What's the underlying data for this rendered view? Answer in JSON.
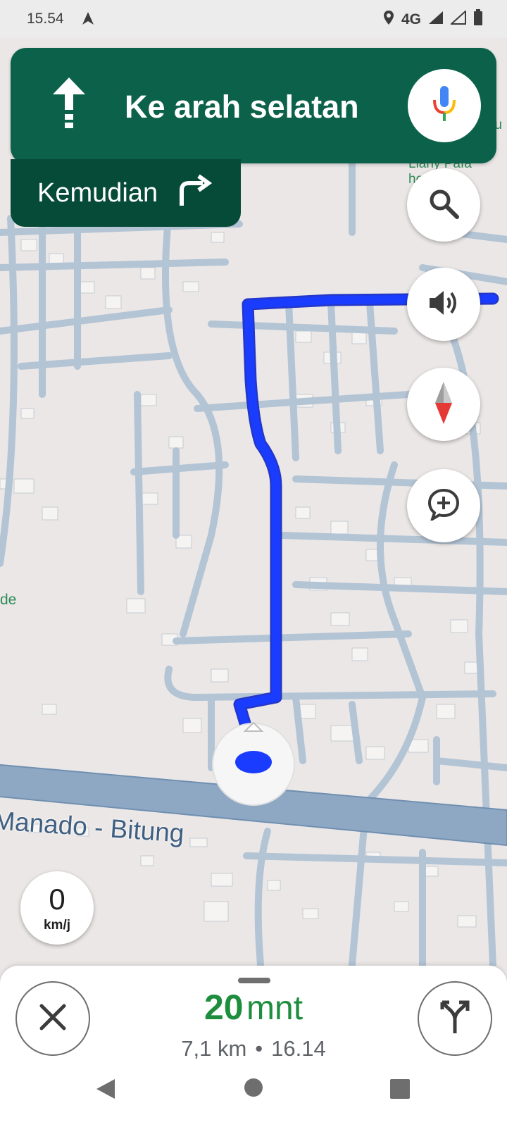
{
  "status_bar": {
    "time": "15.54",
    "network": "4G"
  },
  "map": {
    "road_label": "Manado - Bitung",
    "poi_label": "Liany Pafa home",
    "poi_label_cut": "ru",
    "side_label": "de"
  },
  "direction": {
    "instruction": "Ke arah selatan",
    "then_label": "Kemudian"
  },
  "speed": {
    "value": "0",
    "unit": "km/j"
  },
  "trip": {
    "duration_value": "20",
    "duration_unit": "mnt",
    "distance": "7,1 km",
    "separator": "•",
    "arrival_time": "16.14"
  },
  "colors": {
    "banner": "#0b6149",
    "banner_dark": "#064b37",
    "route": "#1a3cff",
    "eta": "#1e8e3e"
  }
}
